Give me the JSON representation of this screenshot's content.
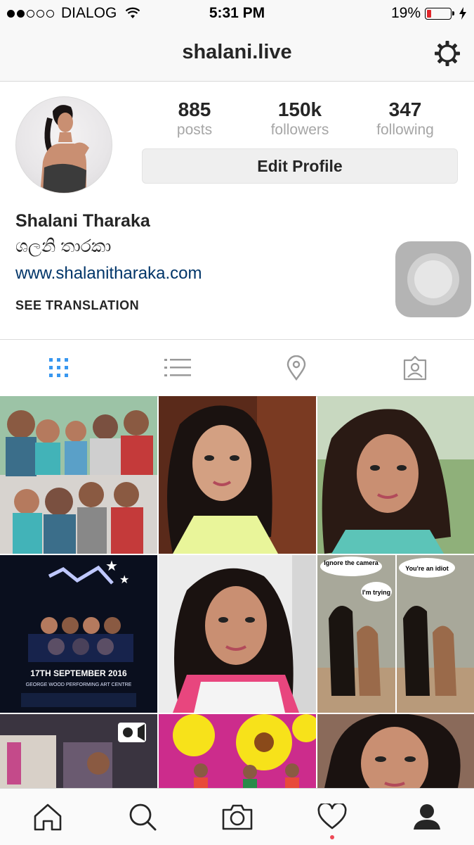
{
  "status_bar": {
    "carrier": "DIALOG",
    "time": "5:31 PM",
    "battery_percent": "19%",
    "battery_level": 0.19,
    "signal_dots_filled": 2,
    "signal_dots_total": 5
  },
  "nav": {
    "title": "shalani.live",
    "settings_icon": "gear-icon"
  },
  "profile": {
    "stats": [
      {
        "value": "885",
        "label": "posts"
      },
      {
        "value": "150k",
        "label": "followers"
      },
      {
        "value": "347",
        "label": "following"
      }
    ],
    "edit_button_label": "Edit Profile",
    "full_name": "Shalani Tharaka",
    "native_name": "ශලනි තාරකා",
    "website": "www.shalanitharaka.com",
    "see_translation": "SEE TRANSLATION"
  },
  "profile_tabs": [
    {
      "icon": "grid-icon",
      "active": true
    },
    {
      "icon": "list-icon",
      "active": false
    },
    {
      "icon": "location-pin-icon",
      "active": false
    },
    {
      "icon": "tagged-person-icon",
      "active": false
    }
  ],
  "grid_posts": {
    "row1": [
      "group-selfie-photo",
      "portrait-photo",
      "portrait-photo"
    ],
    "row2": [
      "event-poster",
      "portrait-photo",
      "dogs-meme"
    ],
    "row3": [
      "video-post",
      "sunflower-stage-photo",
      "portrait-photo"
    ],
    "meme_text": {
      "bubble_1": "Ignore the camera",
      "bubble_2": "I'm trying",
      "bubble_3": "You're an idiot"
    },
    "poster_text": {
      "date": "17TH SEPTEMBER 2016",
      "venue": "GEORGE WOOD PERFORMING ART CENTRE"
    }
  },
  "bottom_nav": [
    {
      "icon": "home-icon"
    },
    {
      "icon": "search-icon"
    },
    {
      "icon": "camera-icon"
    },
    {
      "icon": "heart-icon",
      "has_notification": true
    },
    {
      "icon": "profile-icon",
      "active": true
    }
  ],
  "colors": {
    "accent_blue": "#3897f0",
    "link_blue": "#003569",
    "notification_red": "#ed4956",
    "battery_red": "#e0262b"
  }
}
